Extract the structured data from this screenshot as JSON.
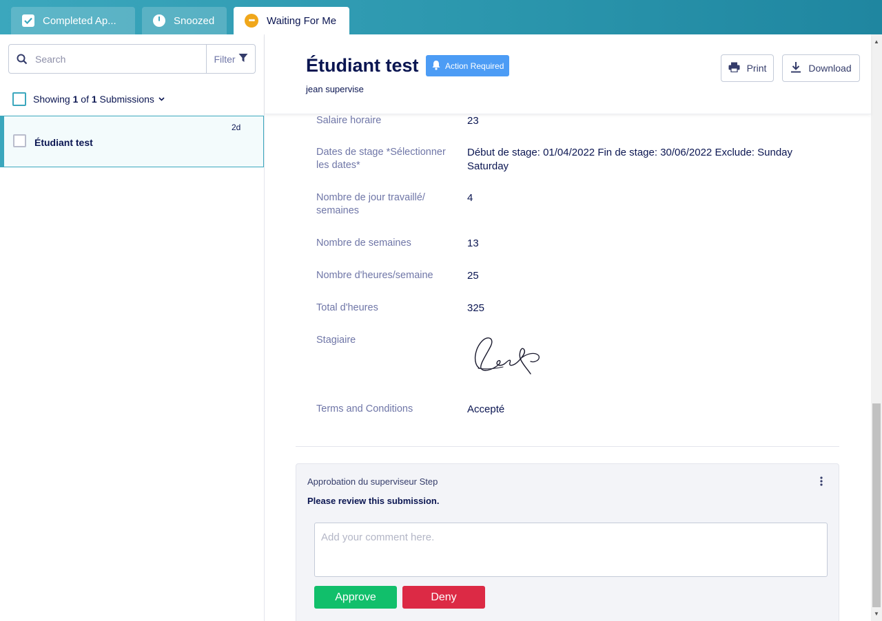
{
  "tabs": [
    {
      "label": "Completed Ap...",
      "icon": "checkbox-icon"
    },
    {
      "label": "Snoozed",
      "icon": "clock-icon"
    },
    {
      "label": "Waiting For Me",
      "icon": "dots-icon",
      "active": true
    }
  ],
  "sidebar": {
    "search_placeholder": "Search",
    "filter_label": "Filter",
    "showing_prefix": "Showing",
    "showing_count": "1",
    "showing_of": "of",
    "showing_total": "1",
    "showing_suffix": "Submissions",
    "items": [
      {
        "name": "Étudiant test",
        "time": "2d"
      }
    ]
  },
  "header": {
    "title": "Étudiant test",
    "badge": "Action Required",
    "subtitle": "jean supervise",
    "print_label": "Print",
    "download_label": "Download"
  },
  "fields": [
    {
      "label": "Salaire horaire",
      "value": "23"
    },
    {
      "label": "Dates de stage *Sélectionner les dates*",
      "value": "Début de stage: 01/04/2022 Fin de stage: 30/06/2022 Exclude: Sunday Saturday"
    },
    {
      "label": "Nombre de jour travaillé/ semaines",
      "value": "4"
    },
    {
      "label": "Nombre de semaines",
      "value": "13"
    },
    {
      "label": "Nombre d'heures/semaine",
      "value": "25"
    },
    {
      "label": "Total d'heures",
      "value": "325"
    },
    {
      "label": "Stagiaire",
      "value": ""
    },
    {
      "label": "Terms and Conditions",
      "value": "Accepté"
    }
  ],
  "step": {
    "title": "Approbation du superviseur Step",
    "message": "Please review this submission.",
    "comment_placeholder": "Add your comment here.",
    "approve_label": "Approve",
    "deny_label": "Deny"
  },
  "colors": {
    "accent": "#3ba7bd",
    "badge": "#4c9cf5",
    "approve": "#11bf6b",
    "deny": "#dc2a45",
    "waiting": "#f0a71b"
  }
}
